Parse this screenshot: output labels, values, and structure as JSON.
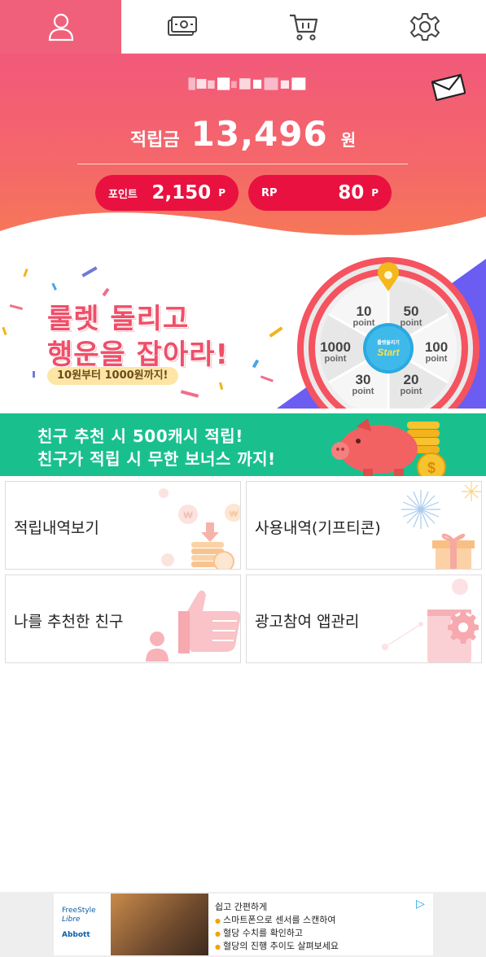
{
  "tabs": [
    {
      "name": "profile",
      "icon": "person-icon",
      "active": true
    },
    {
      "name": "cash",
      "icon": "money-icon",
      "active": false
    },
    {
      "name": "shop",
      "icon": "cart-icon",
      "active": false
    },
    {
      "name": "settings",
      "icon": "gear-icon",
      "active": false
    }
  ],
  "header": {
    "balance_label": "적립금",
    "balance_value": "13,496",
    "balance_unit": "원",
    "points_label": "포인트",
    "points_value": "2,150",
    "points_unit": "P",
    "rp_label": "RP",
    "rp_value": "80",
    "rp_unit": "P"
  },
  "roulette": {
    "title_line1": "룰렛 돌리고",
    "title_line2": "행운을 잡아라!",
    "subtitle": "10원부터 1000원까지!",
    "center_small": "룰렛돌리기",
    "center_start": "Start",
    "segments": [
      {
        "value": "10",
        "unit": "point"
      },
      {
        "value": "50",
        "unit": "point"
      },
      {
        "value": "1000",
        "unit": "point"
      },
      {
        "value": "100",
        "unit": "point"
      },
      {
        "value": "30",
        "unit": "point"
      },
      {
        "value": "20",
        "unit": "point"
      }
    ]
  },
  "referral_banner": {
    "line1": "친구 추천 시 500캐시 적립!",
    "line2": "친구가 적립 시 무한 보너스 까지!"
  },
  "menu": [
    {
      "label": "적립내역보기",
      "icon": "coin-stack-icon"
    },
    {
      "label": "사용내역(기프티콘)",
      "icon": "gift-icon"
    },
    {
      "label": "나를 추천한 친구",
      "icon": "thumbs-up-icon"
    },
    {
      "label": "광고참여 앱관리",
      "icon": "app-gear-icon"
    }
  ],
  "ad": {
    "brand_line1": "FreeStyle",
    "brand_line2": "Libre",
    "brand_line3": "Abbott",
    "headline": "쉽고 간편하게",
    "bullets": [
      "스마트폰으로 센서를 스캔하여",
      "혈당 수치를 확인하고",
      "혈당의 진행 추이도 살펴보세요"
    ]
  },
  "colors": {
    "accent": "#f0607a",
    "pill": "#e9113f",
    "green": "#19c08e"
  }
}
